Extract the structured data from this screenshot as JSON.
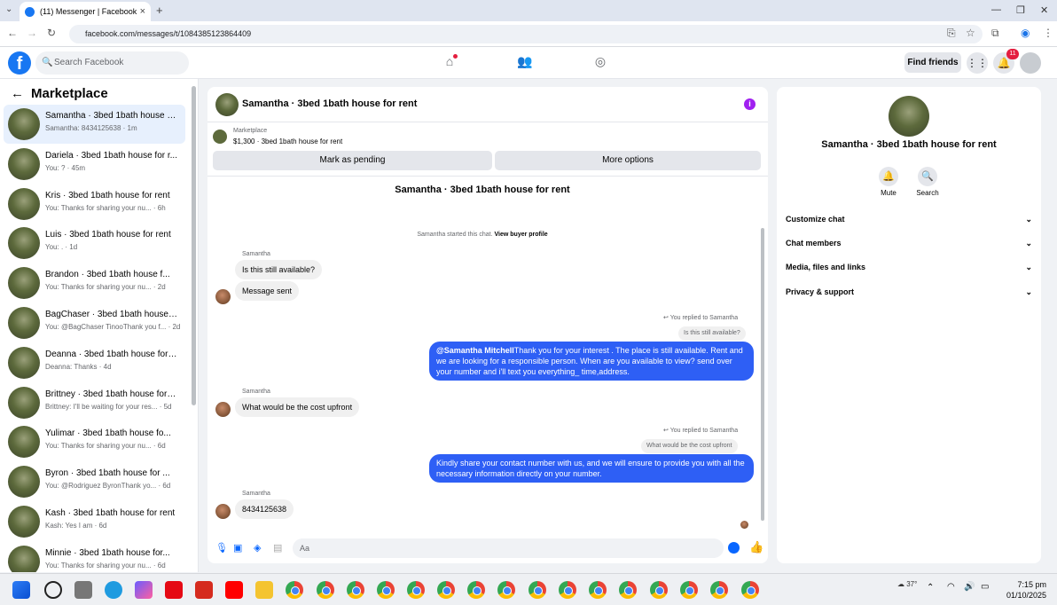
{
  "browser": {
    "tab_title": "(11) Messenger | Facebook",
    "url": "facebook.com/messages/t/1084385123864409"
  },
  "fb": {
    "logo": "f",
    "search_placeholder": "Search Facebook",
    "find_friends": "Find friends",
    "notification_count": "11"
  },
  "sidebar": {
    "title": "Marketplace",
    "conversations": [
      {
        "title": "Samantha · 3bed 1bath house fo...",
        "subtitle": "Samantha: 8434125638 · 1m",
        "active": true
      },
      {
        "title": "Dariela · 3bed 1bath house for r...",
        "subtitle": "You: ? · 45m"
      },
      {
        "title": "Kris · 3bed 1bath house for rent",
        "subtitle": "You: Thanks for sharing your nu... · 6h"
      },
      {
        "title": "Luis · 3bed 1bath house for rent",
        "subtitle": "You: . · 1d"
      },
      {
        "title": "Brandon · 3bed 1bath house f...",
        "subtitle": "You: Thanks for sharing your nu... · 2d"
      },
      {
        "title": "BagChaser · 3bed 1bath house f...",
        "subtitle": "You: @BagChaser TinooThank you f... · 2d"
      },
      {
        "title": "Deanna · 3bed 1bath house for r...",
        "subtitle": "Deanna: Thanks · 4d"
      },
      {
        "title": "Brittney · 3bed 1bath house for r...",
        "subtitle": "Brittney: I'll be waiting for your res... · 5d"
      },
      {
        "title": "Yulimar · 3bed 1bath house fo...",
        "subtitle": "You: Thanks for sharing your nu... · 6d"
      },
      {
        "title": "Byron · 3bed 1bath house for ...",
        "subtitle": "You: @Rodriguez ByronThank yo... · 6d"
      },
      {
        "title": "Kash · 3bed 1bath house for rent",
        "subtitle": "Kash: Yes I am · 6d"
      },
      {
        "title": "Minnie · 3bed 1bath house for...",
        "subtitle": "You: Thanks for sharing your nu... · 6d"
      }
    ]
  },
  "chat": {
    "title": "Samantha · 3bed 1bath house for rent",
    "listing_source": "Marketplace",
    "listing_detail": "$1,300 · 3bed 1bath house for rent",
    "mark_pending": "Mark as pending",
    "more_options": "More options",
    "started_text": "Samantha started this chat.",
    "view_profile": "View buyer profile",
    "sender": "Samantha",
    "msg_1": "Is this still available?",
    "msg_2": "Message sent",
    "replied_label": "You replied to Samantha",
    "quote_1": "Is this still available?",
    "reply_1_mention": "@Samantha Mitchell",
    "reply_1_text": "Thank you for your interest . The place is still available. Rent and we are looking for a responsible person. When are you available to view? send over your number and i'll text you everything_ time,address.",
    "msg_3": "What would be the cost upfront",
    "quote_2": "What would be the cost upfront",
    "reply_2": "Kindly share your contact number with us, and we will ensure to provide you with all the necessary information directly on your number.",
    "msg_4": "8434125638",
    "composer_placeholder": "Aa"
  },
  "details": {
    "name": "Samantha · 3bed 1bath house for rent",
    "mute": "Mute",
    "search": "Search",
    "sections": [
      "Customize chat",
      "Chat members",
      "Media, files and links",
      "Privacy & support"
    ]
  },
  "taskbar": {
    "temperature": "37°",
    "time": "7:15 pm",
    "date": "01/10/2025"
  }
}
